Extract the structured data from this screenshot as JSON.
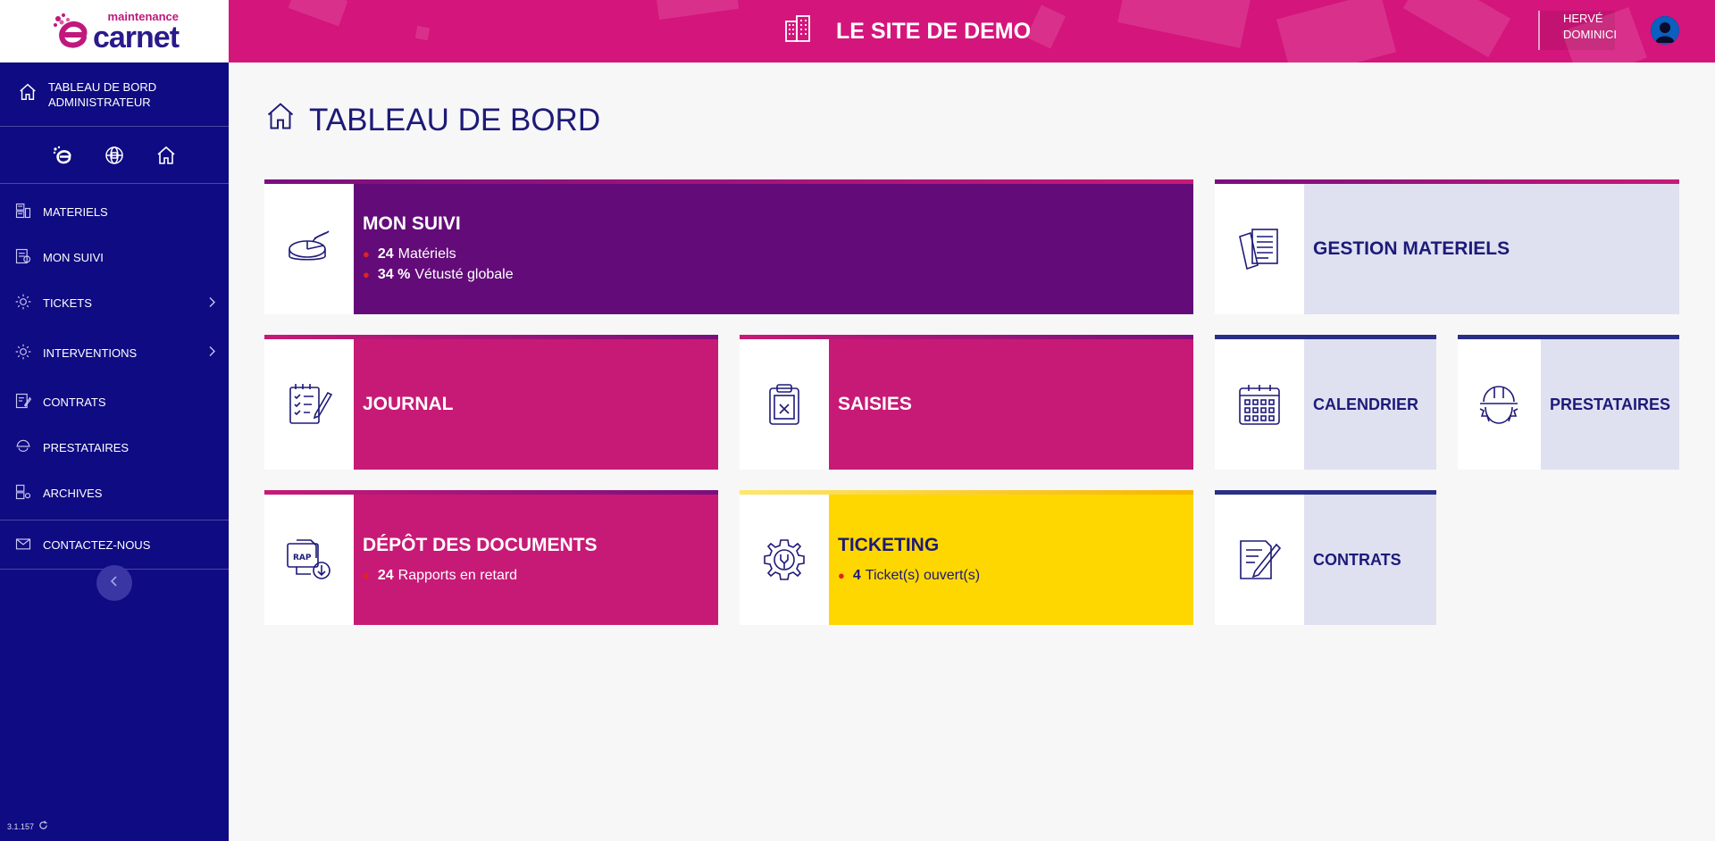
{
  "logo": {
    "small": "maintenance",
    "big": "carnet"
  },
  "sidebar": {
    "dashboard_label": "TABLEAU DE BORD ADMINISTRATEUR",
    "quick_icons": [
      "ecarnet-icon",
      "globe-icon",
      "home-icon"
    ],
    "items": [
      {
        "label": "MATERIELS",
        "icon": "equipment-icon",
        "has_submenu": false
      },
      {
        "label": "MON SUIVI",
        "icon": "tracking-icon",
        "has_submenu": false
      },
      {
        "label": "TICKETS",
        "icon": "tickets-icon",
        "has_submenu": true
      },
      {
        "label": "INTERVENTIONS",
        "icon": "interventions-icon",
        "has_submenu": true
      },
      {
        "label": "CONTRATS",
        "icon": "contracts-icon",
        "has_submenu": false
      },
      {
        "label": "PRESTATAIRES",
        "icon": "providers-icon",
        "has_submenu": false
      },
      {
        "label": "ARCHIVES",
        "icon": "archives-icon",
        "has_submenu": false
      }
    ],
    "contact_label": "CONTACTEZ-NOUS",
    "version": "3.1.157"
  },
  "header": {
    "site_title": "LE SITE DE DEMO",
    "user_first": "HERVÉ",
    "user_last": "DOMINICI"
  },
  "main": {
    "page_title": "TABLEAU DE BORD",
    "tiles": {
      "mon_suivi": {
        "title": "MON SUIVI",
        "stats": [
          {
            "value": "24",
            "text": "Matériels"
          },
          {
            "value": "34 %",
            "text": "Vétusté globale"
          }
        ]
      },
      "gestion_materiels": {
        "title": "GESTION MATERIELS"
      },
      "journal": {
        "title": "JOURNAL"
      },
      "saisies": {
        "title": "SAISIES"
      },
      "calendrier": {
        "title": "CALENDRIER"
      },
      "prestataires": {
        "title": "PRESTATAIRES"
      },
      "depot": {
        "title": "DÉPÔT DES DOCUMENTS",
        "icon_text": "RAP",
        "stats": [
          {
            "value": "24",
            "text": "Rapports en retard"
          }
        ]
      },
      "ticketing": {
        "title": "TICKETING",
        "stats": [
          {
            "value": "4",
            "text": "Ticket(s) ouvert(s)"
          }
        ]
      },
      "contrats": {
        "title": "CONTRATS"
      }
    }
  },
  "colors": {
    "sidebar": "#0f0b82",
    "header": "#d4157c",
    "purple_tile": "#630b79",
    "magenta_tile": "#c71a76",
    "yellow_tile": "#fed700",
    "light_tile": "#dfe1f1",
    "navy_text": "#1d1a78"
  }
}
